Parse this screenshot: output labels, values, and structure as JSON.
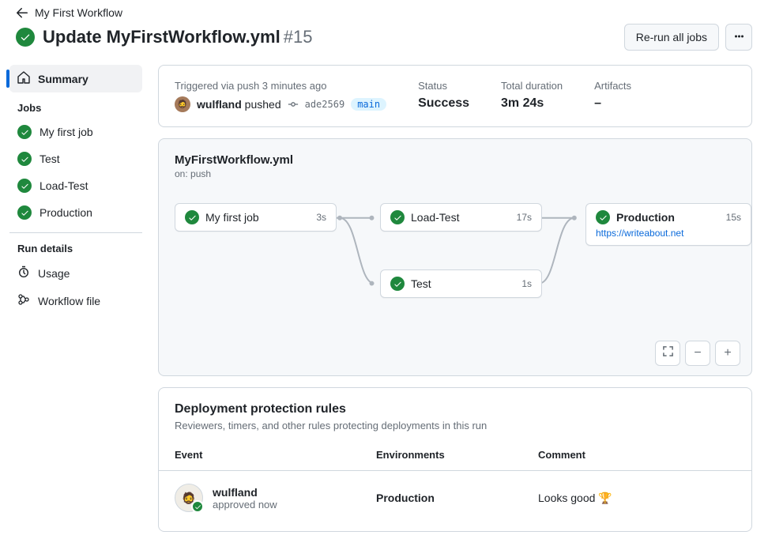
{
  "breadcrumb": {
    "title": "My First Workflow"
  },
  "run": {
    "title": "Update MyFirstWorkflow.yml",
    "number": "#15"
  },
  "actions": {
    "rerun": "Re-run all jobs"
  },
  "sidebar": {
    "summary": "Summary",
    "jobs_heading": "Jobs",
    "items": [
      {
        "label": "My first job"
      },
      {
        "label": "Test"
      },
      {
        "label": "Load-Test"
      },
      {
        "label": "Production"
      }
    ],
    "details_heading": "Run details",
    "usage": "Usage",
    "workflow_file": "Workflow file"
  },
  "summary": {
    "triggered_label": "Triggered via push 3 minutes ago",
    "actor": "wulfland",
    "action": "pushed",
    "commit": "ade2569",
    "branch": "main",
    "status_label": "Status",
    "status_value": "Success",
    "duration_label": "Total duration",
    "duration_value": "3m 24s",
    "artifacts_label": "Artifacts",
    "artifacts_value": "–"
  },
  "graph": {
    "title": "MyFirstWorkflow.yml",
    "trigger": "on: push",
    "nodes": {
      "first": {
        "label": "My first job",
        "time": "3s"
      },
      "load": {
        "label": "Load-Test",
        "time": "17s"
      },
      "test": {
        "label": "Test",
        "time": "1s"
      },
      "prod": {
        "label": "Production",
        "time": "15s",
        "url": "https://writeabout.net"
      }
    }
  },
  "rules": {
    "title": "Deployment protection rules",
    "subtitle": "Reviewers, timers, and other rules protecting deployments in this run",
    "head": {
      "event": "Event",
      "env": "Environments",
      "comment": "Comment"
    },
    "row": {
      "actor": "wulfland",
      "action": "approved now",
      "env": "Production",
      "comment": "Looks good 🏆"
    }
  }
}
